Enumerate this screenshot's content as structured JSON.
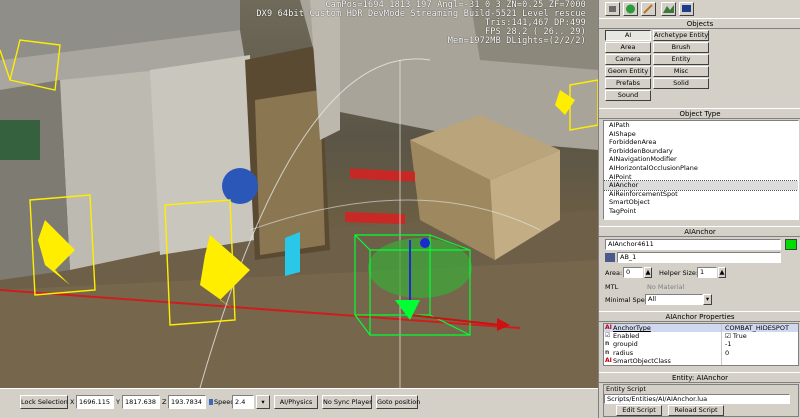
{
  "viewport": {
    "hud": [
      "CamPos=1694 1813 197 Angl=-31  0   3 ZN=0.25 ZF=7000",
      "DX9 64bit Custom HDR DevMode Streaming Build-5521 Level rescue",
      "Tris:141,467  DP:499",
      "FPS   28.2 ( 26.. 29)",
      "Mem=1972MB DLights=(2/2/2)"
    ]
  },
  "toolbar": {
    "icons": [
      "object-icon",
      "globe-icon",
      "brush-icon",
      "terrain-icon",
      "display-icon"
    ]
  },
  "objects_pane": {
    "title": "Objects",
    "buttons": [
      "AI",
      "Archetype Entity",
      "Area",
      "Brush",
      "Camera",
      "Entity",
      "Geom Entity",
      "Misc",
      "Prefabs",
      "Solid",
      "Sound"
    ]
  },
  "object_type_pane": {
    "title": "Object Type",
    "items": [
      "AIPath",
      "AIShape",
      "ForbiddenArea",
      "ForbiddenBoundary",
      "AINavigationModifier",
      "AIHorizontalOcclusionPlane",
      "AIPoint",
      "AIAnchor",
      "AIReinforcementSpot",
      "SmartObject",
      "TagPoint"
    ],
    "selected_index": 7
  },
  "aianchor_pane": {
    "title": "AIAnchor",
    "name_value": "AIAnchor4611",
    "color_swatch": "#00dd00",
    "layer_value": "AB_1",
    "area_label": "Area:",
    "area_value": "0",
    "helper_size_label": "Helper Size:",
    "helper_size_value": "1",
    "mtl_label": "MTL",
    "no_material": "No Material",
    "minimal_spec_label": "Minimal Spec:",
    "minimal_spec_value": "All"
  },
  "properties_pane": {
    "title": "AIAnchor Properties",
    "rows": [
      {
        "key": "AnchorType",
        "value": "COMBAT_HIDESPOT",
        "icon": "AI"
      },
      {
        "key": "Enabled",
        "value": "True",
        "icon": "checkbox"
      },
      {
        "key": "groupid",
        "value": "-1",
        "icon": "n"
      },
      {
        "key": "radius",
        "value": "0",
        "icon": "n"
      },
      {
        "key": "SmartObjectClass",
        "value": "",
        "icon": "AI"
      }
    ]
  },
  "entity_pane": {
    "title": "Entity: AIAnchor",
    "script_label": "Entity Script",
    "script_path": "Scripts/Entities/AI/AIAnchor.lua",
    "edit_script": "Edit Script",
    "reload_script": "Reload Script"
  },
  "statusbar": {
    "lock_selection": "Lock Selection",
    "x_label": "X",
    "x_value": "1696.115",
    "y_label": "Y",
    "y_value": "1817.638",
    "z_label": "Z",
    "z_value": "193.7834",
    "speed_label": "Speed:",
    "speed_value": "2.4",
    "ai_physics": "AI/Physics",
    "no_sync_player": "No Sync Player",
    "goto_position": "Goto position"
  }
}
